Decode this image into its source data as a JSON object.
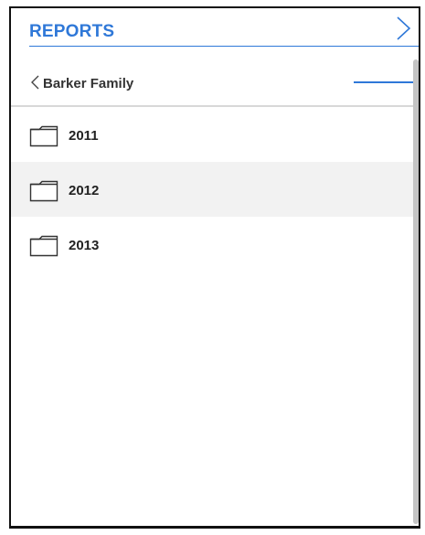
{
  "header": {
    "title": "REPORTS",
    "forward_icon": "chevron-right-icon",
    "accent_color": "#2f78d8"
  },
  "breadcrumb": {
    "back_icon": "chevron-left-icon",
    "label": "Barker Family"
  },
  "folders": [
    {
      "label": "2011",
      "icon": "folder-icon",
      "selected": false
    },
    {
      "label": "2012",
      "icon": "folder-icon",
      "selected": true
    },
    {
      "label": "2013",
      "icon": "folder-icon",
      "selected": false
    }
  ]
}
